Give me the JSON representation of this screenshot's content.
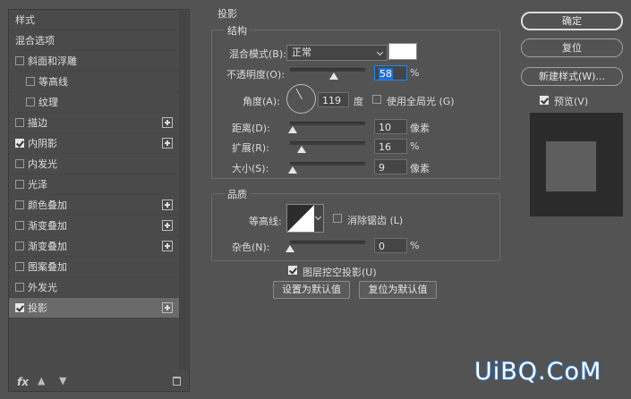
{
  "left_panel": {
    "items": [
      {
        "label": "样式",
        "checkbox": false,
        "checked": false,
        "plus": false,
        "selected": false,
        "indent": 0
      },
      {
        "label": "混合选项",
        "checkbox": false,
        "checked": false,
        "plus": false,
        "selected": false,
        "indent": 0
      },
      {
        "label": "斜面和浮雕",
        "checkbox": true,
        "checked": false,
        "plus": false,
        "selected": false,
        "indent": 0
      },
      {
        "label": "等高线",
        "checkbox": true,
        "checked": false,
        "plus": false,
        "selected": false,
        "indent": 1
      },
      {
        "label": "纹理",
        "checkbox": true,
        "checked": false,
        "plus": false,
        "selected": false,
        "indent": 1
      },
      {
        "label": "描边",
        "checkbox": true,
        "checked": false,
        "plus": true,
        "selected": false,
        "indent": 0
      },
      {
        "label": "内阴影",
        "checkbox": true,
        "checked": true,
        "plus": true,
        "selected": false,
        "indent": 0
      },
      {
        "label": "内发光",
        "checkbox": true,
        "checked": false,
        "plus": false,
        "selected": false,
        "indent": 0
      },
      {
        "label": "光泽",
        "checkbox": true,
        "checked": false,
        "plus": false,
        "selected": false,
        "indent": 0
      },
      {
        "label": "颜色叠加",
        "checkbox": true,
        "checked": false,
        "plus": true,
        "selected": false,
        "indent": 0
      },
      {
        "label": "渐变叠加",
        "checkbox": true,
        "checked": false,
        "plus": true,
        "selected": false,
        "indent": 0
      },
      {
        "label": "渐变叠加",
        "checkbox": true,
        "checked": false,
        "plus": true,
        "selected": false,
        "indent": 0
      },
      {
        "label": "图案叠加",
        "checkbox": true,
        "checked": false,
        "plus": false,
        "selected": false,
        "indent": 0
      },
      {
        "label": "外发光",
        "checkbox": true,
        "checked": false,
        "plus": false,
        "selected": false,
        "indent": 0
      },
      {
        "label": "投影",
        "checkbox": true,
        "checked": true,
        "plus": true,
        "selected": true,
        "indent": 0
      }
    ],
    "footer": {
      "fx_label": "fx",
      "icons": [
        "up-arrow-icon",
        "down-arrow-icon",
        "trash-icon"
      ]
    }
  },
  "shadow": {
    "section_title": "投影",
    "structure": {
      "title": "结构",
      "blend_mode_label": "混合模式(B):",
      "blend_mode_value": "正常",
      "shadow_color": "#ffffff",
      "opacity_label": "不透明度(O):",
      "opacity_value": "58",
      "opacity_unit": "%",
      "opacity_fraction": 0.58,
      "angle_label": "角度(A):",
      "angle_value": "119",
      "angle_unit": "度",
      "global_light_label": "使用全局光 (G)",
      "global_light_checked": false,
      "distance_label": "距离(D):",
      "distance_value": "10",
      "distance_unit": "像素",
      "distance_fraction": 0.04,
      "spread_label": "扩展(R):",
      "spread_value": "16",
      "spread_unit": "%",
      "spread_fraction": 0.16,
      "size_label": "大小(S):",
      "size_value": "9",
      "size_unit": "像素",
      "size_fraction": 0.04
    },
    "quality": {
      "title": "品质",
      "contour_label": "等高线:",
      "anti_alias_label": "消除锯齿 (L)",
      "anti_alias_checked": false,
      "noise_label": "杂色(N):",
      "noise_value": "0",
      "noise_unit": "%",
      "noise_fraction": 0
    },
    "knockout_label": "图层挖空投影(U)",
    "knockout_checked": true,
    "set_default_label": "设置为默认值",
    "reset_default_label": "复位为默认值"
  },
  "right": {
    "ok_label": "确定",
    "reset_label": "复位",
    "new_style_label": "新建样式(W)...",
    "preview_label": "预览(V)",
    "preview_checked": true
  },
  "watermark": "UiBQ.CoM"
}
